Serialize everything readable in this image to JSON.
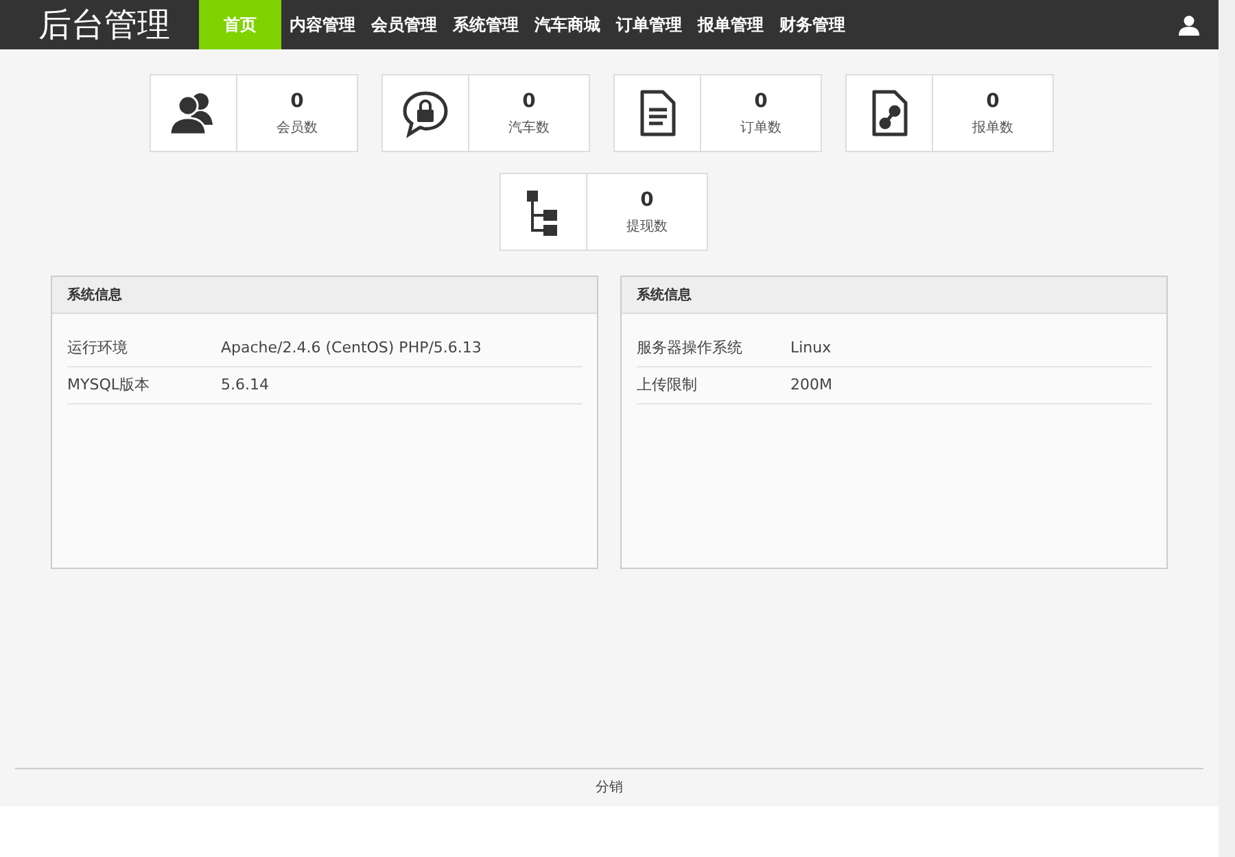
{
  "header": {
    "title": "后台管理",
    "nav": [
      {
        "label": "首页",
        "selected": true
      },
      {
        "label": "内容管理",
        "selected": false
      },
      {
        "label": "会员管理",
        "selected": false
      },
      {
        "label": "系统管理",
        "selected": false
      },
      {
        "label": "汽车商城",
        "selected": false
      },
      {
        "label": "订单管理",
        "selected": false
      },
      {
        "label": "报单管理",
        "selected": false
      },
      {
        "label": "财务管理",
        "selected": false
      }
    ]
  },
  "stats": [
    {
      "kind": "members",
      "value": "0",
      "label": "会员数"
    },
    {
      "kind": "cars",
      "value": "0",
      "label": "汽车数"
    },
    {
      "kind": "orders",
      "value": "0",
      "label": "订单数"
    },
    {
      "kind": "reports",
      "value": "0",
      "label": "报单数"
    },
    {
      "kind": "withdrawals",
      "value": "0",
      "label": "提现数"
    }
  ],
  "panels": [
    {
      "title": "系统信息",
      "rows": [
        {
          "label": "运行环境",
          "value": "Apache/2.4.6 (CentOS) PHP/5.6.13"
        },
        {
          "label": "MYSQL版本",
          "value": "5.6.14"
        }
      ]
    },
    {
      "title": "系统信息",
      "rows": [
        {
          "label": "服务器操作系统",
          "value": "Linux"
        },
        {
          "label": "上传限制",
          "value": "200M"
        }
      ]
    }
  ],
  "footer": {
    "text": "分销"
  }
}
